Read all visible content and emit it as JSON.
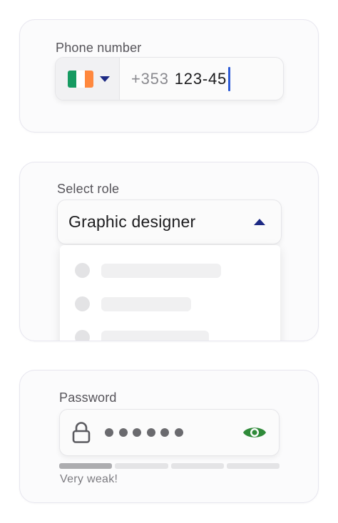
{
  "phone": {
    "label": "Phone number",
    "country_flag_colors": [
      "#169b62",
      "#ffffff",
      "#ff883e"
    ],
    "prefix": "+353",
    "value": "123-45"
  },
  "role": {
    "label": "Select role",
    "selected": "Graphic designer"
  },
  "password": {
    "label": "Password",
    "masked_length": 6,
    "strength_level": 1,
    "strength_segments": 4,
    "strength_text": "Very weak!",
    "eye_color": "#2f8a39"
  },
  "colors": {
    "caret": "#1d2a84",
    "cursor": "#2d5bd6"
  }
}
